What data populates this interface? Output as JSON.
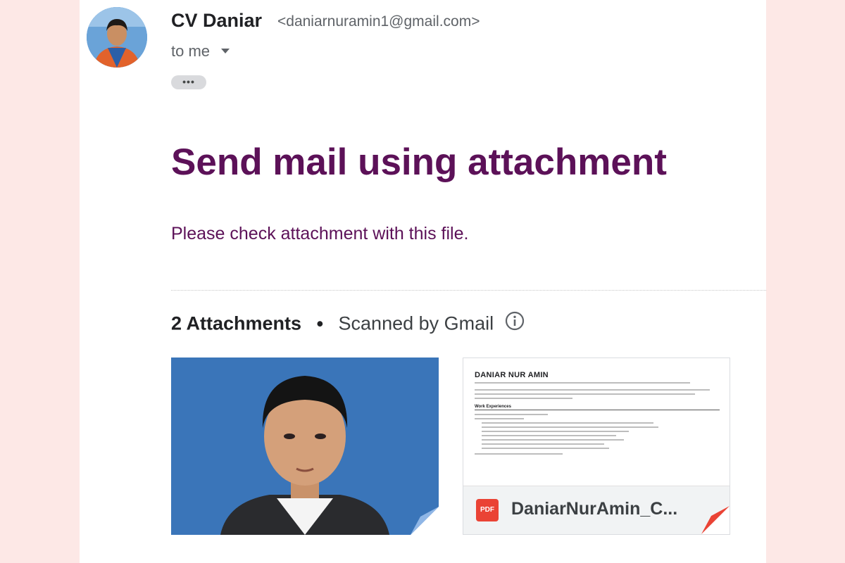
{
  "sender": {
    "name": "CV Daniar",
    "email": "<daniarnuramin1@gmail.com>",
    "recipient_label": "to me"
  },
  "ellipsis_label": "•••",
  "message": {
    "subject": "Send mail using attachment",
    "body": "Please check attachment with this file."
  },
  "attachments": {
    "count_label": "2 Attachments",
    "separator": "•",
    "scan_label": "Scanned by Gmail",
    "items": [
      {
        "type": "image",
        "subject": "portrait photo, blue background"
      },
      {
        "type": "pdf",
        "badge": "PDF",
        "filename": "DaniarNurAmin_C...",
        "preview_title": "DANIAR NUR AMIN",
        "preview_section": "Work Experiences"
      }
    ]
  },
  "colors": {
    "background": "#fde8e6",
    "subject_text": "#5c1158",
    "pdf_red": "#ea4335",
    "photo_blue": "#3a75b9"
  },
  "icons": {
    "recipient_toggle": "chevron-down-icon",
    "scan_info": "info-icon",
    "pdf_file": "pdf-icon"
  }
}
